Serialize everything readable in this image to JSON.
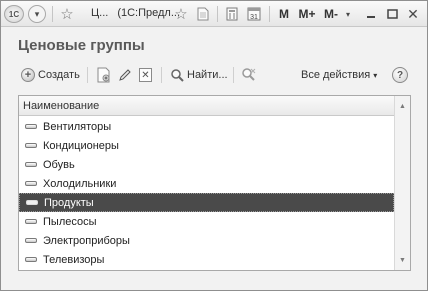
{
  "titlebar": {
    "logo": "1С",
    "title_short": "Ц...",
    "title_app": "(1С:Предл...",
    "m_label": "M",
    "mplus_label": "M+",
    "mminus_label": "M-",
    "icons": [
      "logo-icon",
      "menu-icon",
      "star-icon",
      "star-icon",
      "document-icon",
      "calculator-icon",
      "calendar-icon",
      "minimize-icon",
      "maximize-icon",
      "close-icon"
    ]
  },
  "form": {
    "title": "Ценовые группы"
  },
  "toolbar": {
    "create_label": "Создать",
    "find_label": "Найти...",
    "all_actions_label": "Все действия",
    "help_label": "?"
  },
  "table": {
    "column_header": "Наименование",
    "rows": [
      "Вентиляторы",
      "Кондиционеры",
      "Обувь",
      "Холодильники",
      "Продукты",
      "Пылесосы",
      "Электроприборы",
      "Телевизоры"
    ],
    "selected_index": 4
  },
  "colors": {
    "selection": "#4a4a4a",
    "title": "#5a5a5a",
    "window_bg": "#f2f2f2"
  }
}
